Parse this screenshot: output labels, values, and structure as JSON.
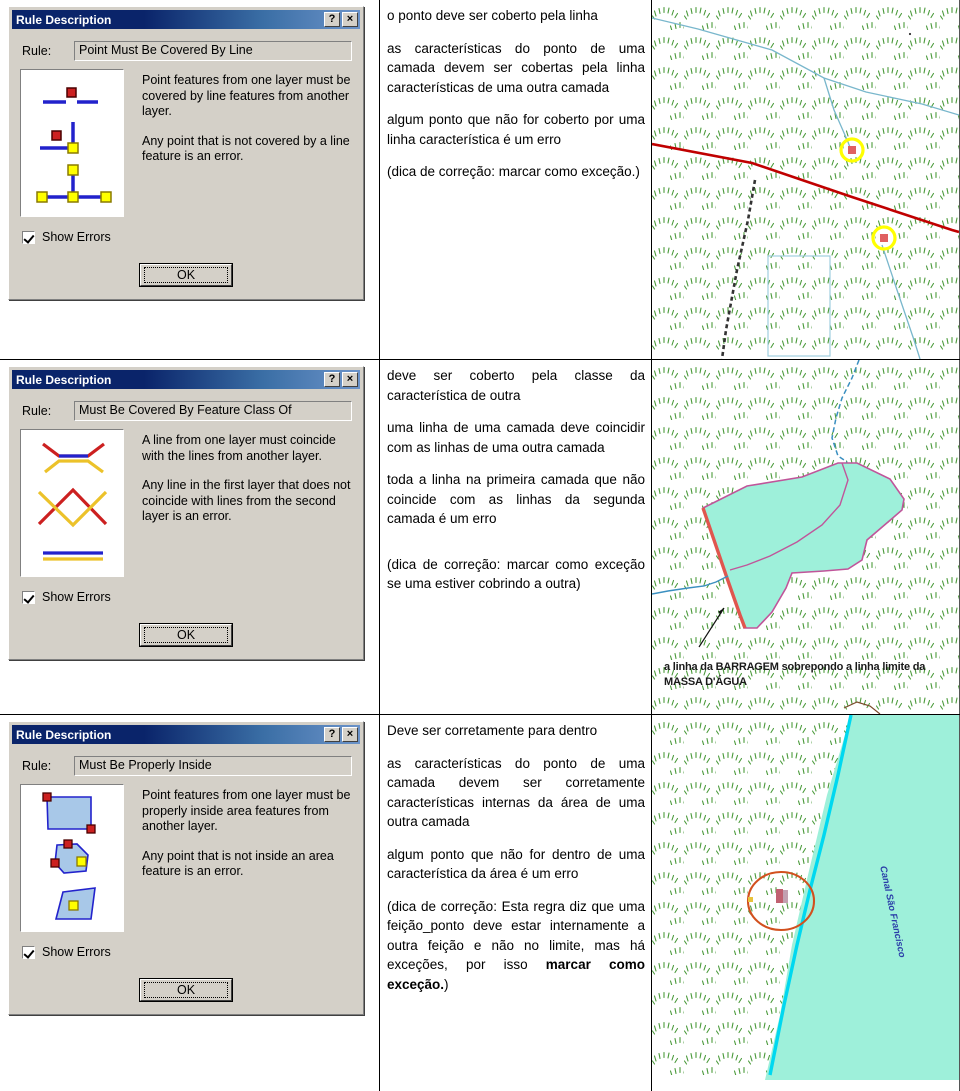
{
  "document": {
    "title": "Rule Description comparison table",
    "rows": [
      {
        "id": "row-point-must-be-covered-by-line",
        "dialog": {
          "titlebar": "Rule Description",
          "help_button": "?",
          "close_button": "×",
          "rule_label": "Rule:",
          "rule_value": "Point Must Be Covered By Line",
          "description": [
            "Point features from one layer must be covered by line features from another layer.",
            "Any point that is not covered by a line feature is an error."
          ],
          "show_errors_label": "Show Errors",
          "show_errors_checked": true,
          "ok_label": "OK",
          "diagram": "point-covered-by-line-diagram"
        },
        "text": [
          {
            "content": "o ponto deve ser coberto pela linha",
            "bold": false
          },
          {
            "content": "as características do ponto de uma camada devem ser cobertas pela linha características de uma outra camada",
            "bold": false
          },
          {
            "content": "algum ponto que não for coberto por uma linha característica é um erro",
            "bold": false
          },
          {
            "content": "(dica de correção: marcar como exceção.)",
            "bold": false
          }
        ],
        "map": {
          "name": "map-point-not-covered-by-line",
          "caption": "",
          "river_label": ""
        }
      },
      {
        "id": "row-must-be-covered-by-feature-class-of",
        "dialog": {
          "titlebar": "Rule Description",
          "help_button": "?",
          "close_button": "×",
          "rule_label": "Rule:",
          "rule_value": "Must Be Covered By Feature Class Of",
          "description": [
            "A line from one layer must coincide with the lines from another layer.",
            "Any line in the first layer that does not coincide with lines from the second layer is an error."
          ],
          "show_errors_label": "Show Errors",
          "show_errors_checked": true,
          "ok_label": "OK",
          "diagram": "line-coincide-diagram"
        },
        "text": [
          {
            "content": "deve ser coberto pela classe da característica de outra",
            "bold": false
          },
          {
            "content": "uma linha de uma camada deve coincidir com as linhas de uma outra camada",
            "bold": false
          },
          {
            "content": "toda a linha na primeira camada que não coincide com as linhas da segunda camada é um erro",
            "bold": false
          },
          {
            "content": "(dica de correção: marcar como exceção se uma estiver cobrindo a outra)",
            "bold": false
          }
        ],
        "map": {
          "name": "map-barragem-massa-dagua",
          "caption": "a linha da BARRAGEM sobrepondo a linha limite da MASSA D'ÁGUA",
          "river_label": ""
        }
      },
      {
        "id": "row-must-be-properly-inside",
        "dialog": {
          "titlebar": "Rule Description",
          "help_button": "?",
          "close_button": "×",
          "rule_label": "Rule:",
          "rule_value": "Must Be Properly Inside",
          "description": [
            "Point features from one layer must be properly inside area features from another layer.",
            "Any point that is not inside an area feature is an error."
          ],
          "show_errors_label": "Show Errors",
          "show_errors_checked": true,
          "ok_label": "OK",
          "diagram": "point-inside-area-diagram"
        },
        "text": [
          {
            "content": "Deve ser corretamente para dentro",
            "bold": false
          },
          {
            "content": "as características do ponto de uma camada devem ser corretamente características internas da área de uma outra camada",
            "bold": false
          },
          {
            "content": "algum ponto que não for dentro de uma característica da área é um erro",
            "bold": false
          },
          {
            "content": "(dica de correção: Esta regra diz que uma feição_ponto deve estar internamente a outra feição e não no limite, mas há exceções, por isso ",
            "bold_tail": "marcar como exceção.",
            "tail_after": ")"
          }
        ],
        "map": {
          "name": "map-canal-sao-francisco",
          "caption": "",
          "river_label": "Canal São Francisco"
        }
      }
    ]
  },
  "colors": {
    "titlebar_start": "#0a246a",
    "titlebar_end": "#6b93c9",
    "dialog_face": "#d4d0c8",
    "vegetation_green": "#4a9a3a",
    "water_fill": "#9ef0da",
    "water_line": "#00d8f0",
    "error_red": "#c00000",
    "highlight_yellow": "#ffff00",
    "highlight_orange": "#d2501e",
    "polygon_pink": "#c0559a",
    "point_red": "#e06060",
    "diagram_blue": "#2222cc",
    "diagram_yellow": "#ffff00",
    "diagram_dark_red": "#cc2020",
    "diagram_gold": "#ecc22a",
    "poly_fill_blue": "#a8c8e8"
  }
}
